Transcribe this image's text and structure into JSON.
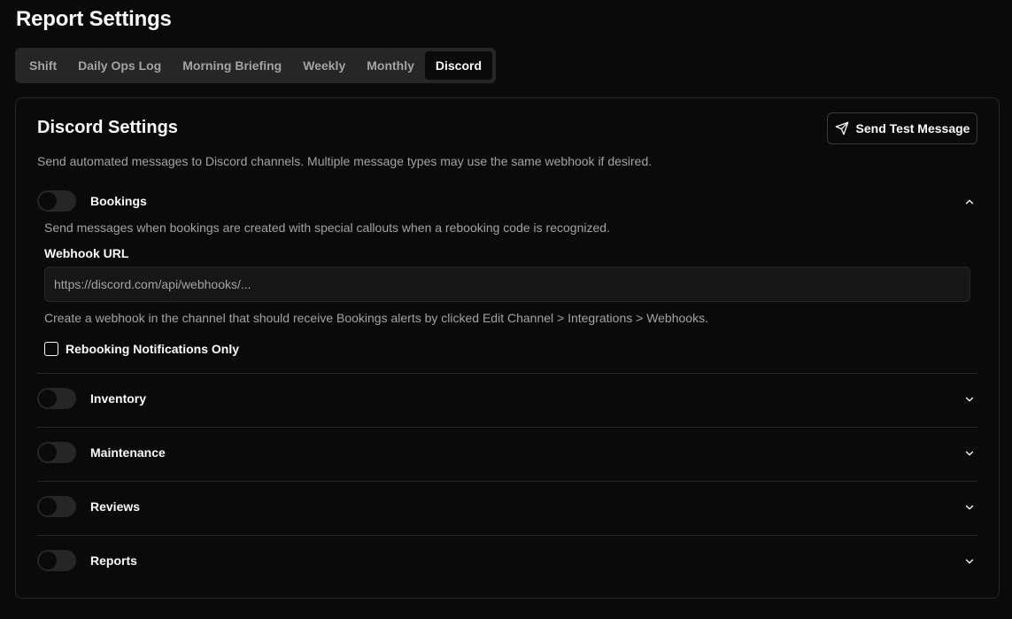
{
  "page": {
    "title": "Report Settings"
  },
  "tabs": [
    {
      "label": "Shift",
      "active": false
    },
    {
      "label": "Daily Ops Log",
      "active": false
    },
    {
      "label": "Morning Briefing",
      "active": false
    },
    {
      "label": "Weekly",
      "active": false
    },
    {
      "label": "Monthly",
      "active": false
    },
    {
      "label": "Discord",
      "active": true
    }
  ],
  "discord": {
    "title": "Discord Settings",
    "test_button_label": "Send Test Message",
    "description": "Send automated messages to Discord channels. Multiple message types may use the same webhook if desired.",
    "sections": [
      {
        "label": "Bookings",
        "expanded": true,
        "enabled": false,
        "description": "Send messages when bookings are created with special callouts when a rebooking code is recognized.",
        "webhook_label": "Webhook URL",
        "webhook_placeholder": "https://discord.com/api/webhooks/...",
        "help_text": "Create a webhook in the channel that should receive Bookings alerts by clicked Edit Channel > Integrations > Webhooks.",
        "checkbox_label": "Rebooking Notifications Only",
        "checkbox_checked": false
      },
      {
        "label": "Inventory",
        "expanded": false,
        "enabled": false
      },
      {
        "label": "Maintenance",
        "expanded": false,
        "enabled": false
      },
      {
        "label": "Reviews",
        "expanded": false,
        "enabled": false
      },
      {
        "label": "Reports",
        "expanded": false,
        "enabled": false
      }
    ]
  },
  "icons": {
    "send": "send-icon",
    "chevron_up": "chevron-up-icon",
    "chevron_down": "chevron-down-icon"
  }
}
